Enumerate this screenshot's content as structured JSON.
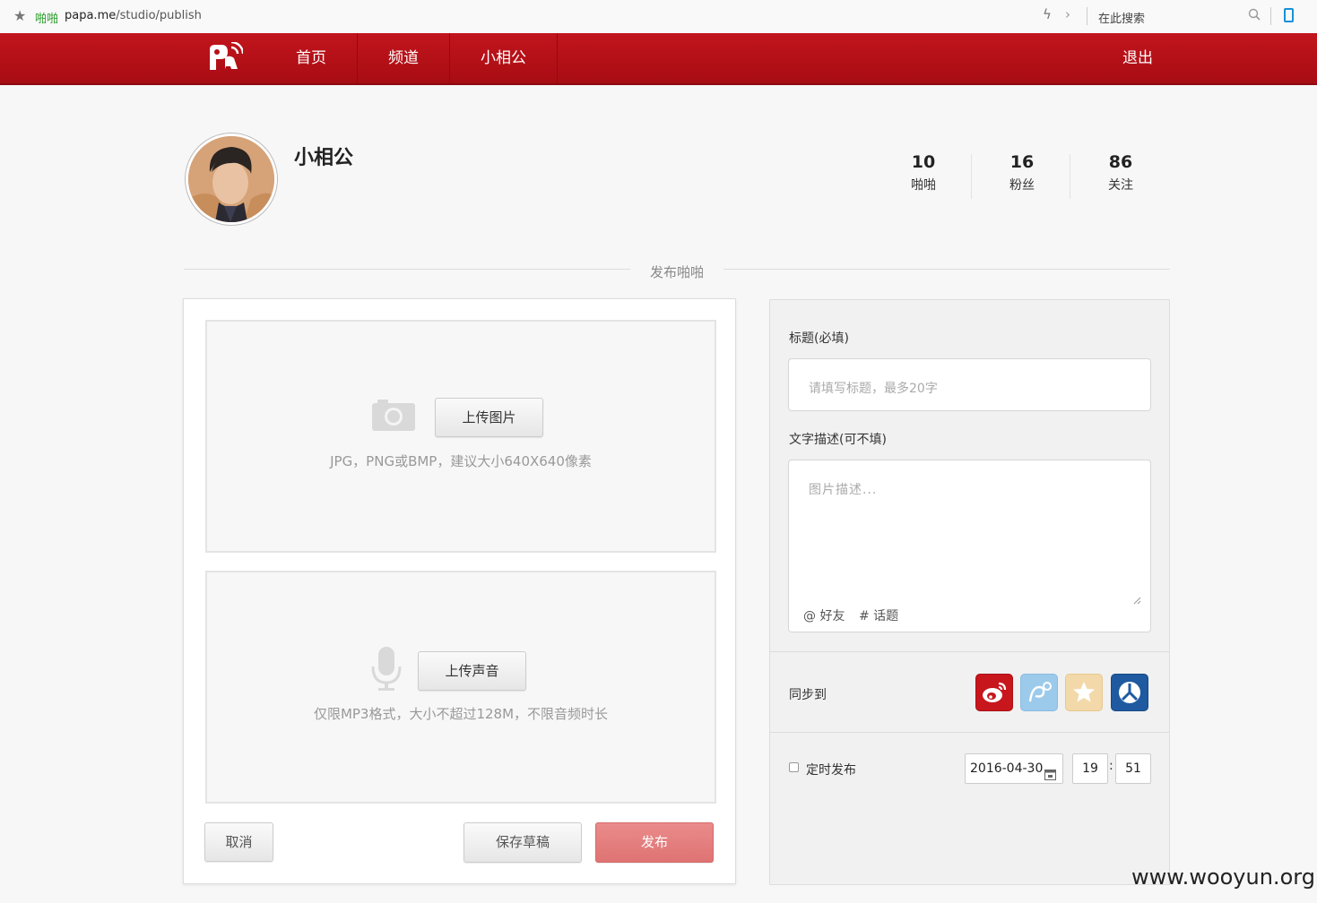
{
  "browser": {
    "site_name": "啪啪",
    "url_domain": "papa.me",
    "url_path": "/studio/publish",
    "search_placeholder": "在此搜索"
  },
  "nav": {
    "items": [
      {
        "label": "首页"
      },
      {
        "label": "频道"
      },
      {
        "label": "小相公"
      }
    ],
    "logout": "退出"
  },
  "profile": {
    "name": "小相公",
    "stats": [
      {
        "value": "10",
        "label": "啪啪"
      },
      {
        "value": "16",
        "label": "粉丝"
      },
      {
        "value": "86",
        "label": "关注"
      }
    ]
  },
  "section_title": "发布啪啪",
  "upload": {
    "image_button": "上传图片",
    "image_hint": "JPG，PNG或BMP，建议大小640X640像素",
    "audio_button": "上传声音",
    "audio_hint": "仅限MP3格式，大小不超过128M，不限音频时长"
  },
  "actions": {
    "cancel": "取消",
    "save_draft": "保存草稿",
    "publish": "发布"
  },
  "form": {
    "title_label": "标题(必填)",
    "title_placeholder": "请填写标题，最多20字",
    "desc_label": "文字描述(可不填)",
    "desc_placeholder": "图片描述...",
    "mention": "@ 好友",
    "topic": "# 话题",
    "sync_label": "同步到",
    "share_icons": [
      "weibo-icon",
      "tencent-weibo-icon",
      "qzone-icon",
      "renren-icon"
    ],
    "share_colors": [
      "#c8161d",
      "#9ccaeb",
      "#f3d9a9",
      "#1f5aa0"
    ],
    "schedule_label": "定时发布",
    "schedule_checked": false,
    "date": "2016-04-30",
    "hour": "19",
    "colon": ":",
    "minute": "51"
  },
  "watermark": "www.wooyun.org"
}
